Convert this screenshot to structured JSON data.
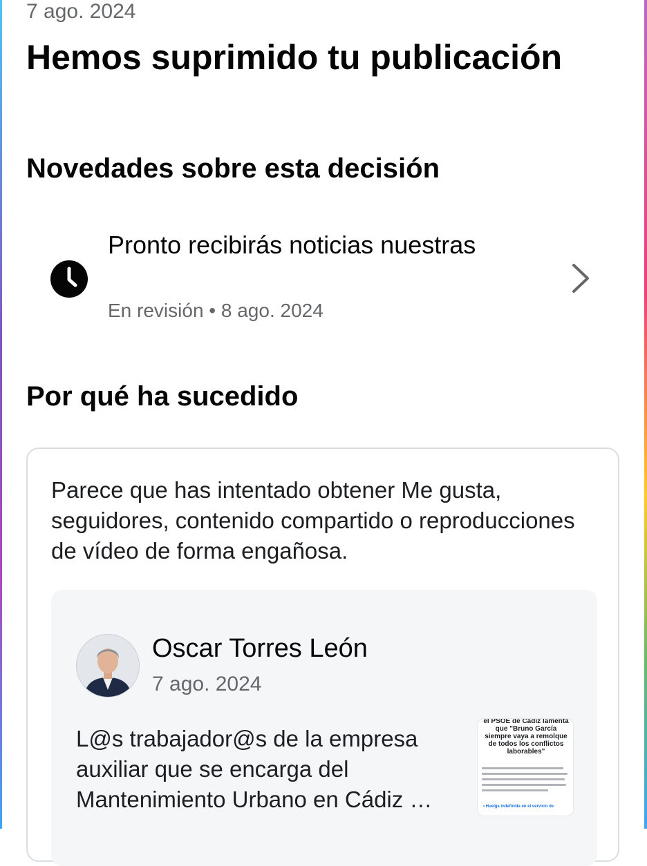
{
  "header": {
    "date": "7 ago. 2024",
    "title": "Hemos suprimido tu publicación"
  },
  "updates": {
    "section_title": "Novedades sobre esta decisión",
    "item": {
      "icon": "clock-icon",
      "title": "Pronto recibirás noticias nuestras",
      "status": "En revisión",
      "date": "8 ago. 2024",
      "subtitle": "En revisión • 8 ago. 2024",
      "chevron": "chevron-right-icon"
    }
  },
  "reason": {
    "section_title": "Por qué ha sucedido",
    "text": "Parece que has intentado obtener Me gusta, seguidores, contenido compartido o reproducciones de vídeo de forma engañosa.",
    "post": {
      "author": "Oscar Torres León",
      "date": "7 ago. 2024",
      "text": "L@s trabajador@s de la empresa auxiliar que se encarga del Mantenimiento Urbano en Cádiz …",
      "thumbnail": {
        "headline": "el PSOE de Cádiz lamenta que \"Bruno García siempre vaya a remolque de todos los conflictos laborables\"",
        "link_text": "• Huelga indefinida en el servicio de"
      }
    }
  },
  "colors": {
    "text_primary": "#050505",
    "text_secondary": "#65676b",
    "card_border": "#dadde1",
    "post_background": "#f5f6f7"
  }
}
